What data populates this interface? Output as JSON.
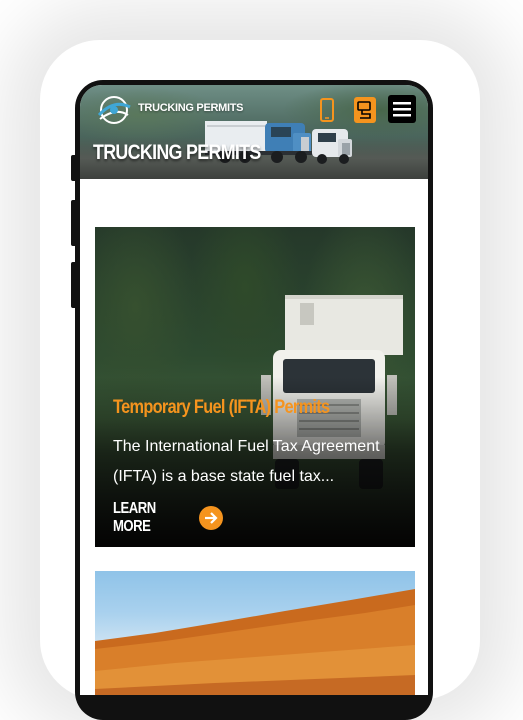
{
  "header": {
    "brand_text": "TRUCKING PERMITS",
    "page_title": "TRUCKING PERMITS"
  },
  "icons": {
    "logo": "company-logo",
    "phone": "phone-icon",
    "quote": "quote-request-icon",
    "menu": "hamburger-menu-icon",
    "arrow": "arrow-right-icon"
  },
  "cards": [
    {
      "title": "Temporary Fuel (IFTA) Permits",
      "description": "The International Fuel Tax Agreement (IFTA) is a base state fuel tax...",
      "cta_label": "LEARN MORE"
    }
  ],
  "colors": {
    "accent": "#f5941e",
    "menu_bg": "#000000",
    "text_light": "#ffffff"
  }
}
